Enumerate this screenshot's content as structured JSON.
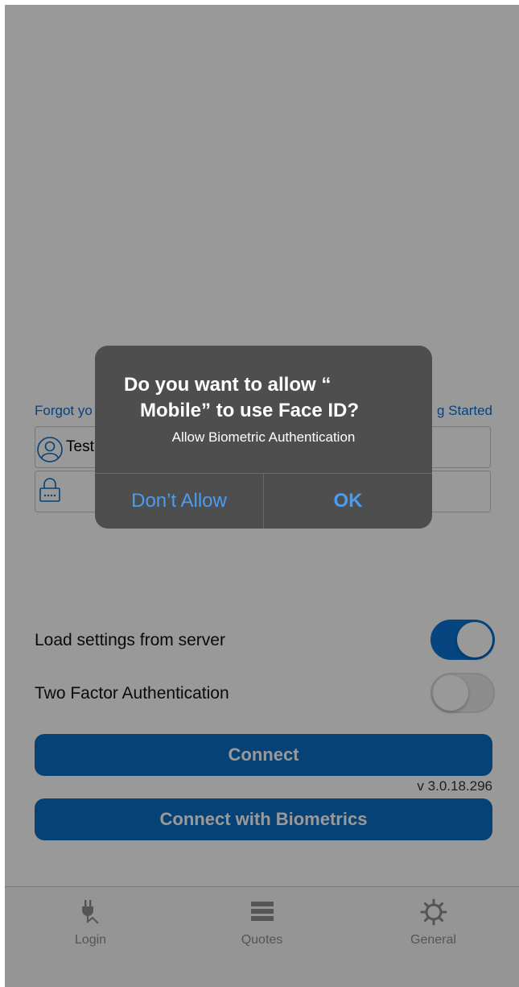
{
  "login": {
    "forgot_link": "Forgot yo",
    "getting_started_link": "g Started",
    "username_value": "Test",
    "password_value": ""
  },
  "settings": {
    "load_settings_label": "Load settings from server",
    "load_settings_on": true,
    "two_factor_label": "Two Factor Authentication",
    "two_factor_on": false
  },
  "buttons": {
    "connect_label": "Connect",
    "biometrics_label": "Connect with Biometrics"
  },
  "version": "v 3.0.18.296",
  "tab_bar": {
    "tabs": [
      {
        "label": "Login",
        "icon": "plug-icon"
      },
      {
        "label": "Quotes",
        "icon": "list-icon"
      },
      {
        "label": "General",
        "icon": "gear-icon"
      }
    ]
  },
  "alert": {
    "title_line1": "Do you want to allow “",
    "title_line2": "Mobile” to use Face ID?",
    "message": "Allow Biometric Authentication",
    "dont_allow_label": "Don’t Allow",
    "ok_label": "OK"
  },
  "colors": {
    "accent": "#0a6fc4",
    "alert_button": "#4b9cf0"
  }
}
